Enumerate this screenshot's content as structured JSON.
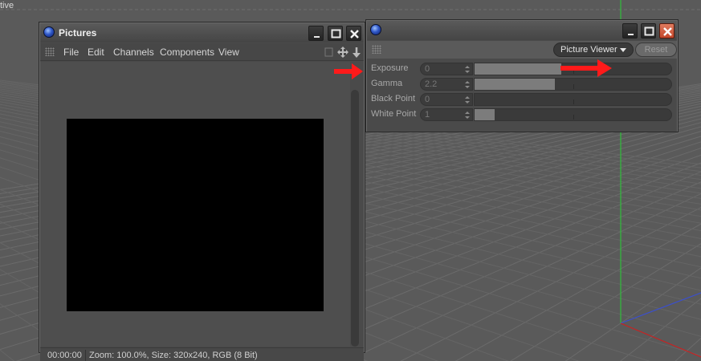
{
  "viewport": {
    "label": "tive"
  },
  "pictures_window": {
    "title": "Pictures",
    "menu": [
      "File",
      "Edit",
      "Channels",
      "Components",
      "View"
    ],
    "status": {
      "time": "00:00:00",
      "info": "Zoom: 100.0%, Size: 320x240, RGB (8 Bit)"
    }
  },
  "attributes_window": {
    "mode_dropdown": "Picture Viewer",
    "reset_label": "Reset",
    "rows": [
      {
        "label": "Exposure",
        "value": "0",
        "fill": 0.44
      },
      {
        "label": "Gamma",
        "value": "2.2",
        "fill": 0.41
      },
      {
        "label": "Black Point",
        "value": "0",
        "fill": 0
      },
      {
        "label": "White Point",
        "value": "1",
        "fill": 0.1
      }
    ]
  },
  "colors": {
    "annotation_arrow": "#ff1a1a",
    "close_button": "#d45a3c",
    "y_axis": "#2fbf3a",
    "x_axis": "#cc2020"
  }
}
